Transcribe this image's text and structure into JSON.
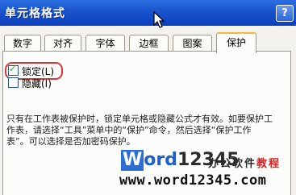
{
  "window": {
    "title": "单元格格式",
    "help_glyph": "?"
  },
  "tabs": [
    {
      "label": "数字"
    },
    {
      "label": "对齐"
    },
    {
      "label": "字体"
    },
    {
      "label": "边框"
    },
    {
      "label": "图案"
    },
    {
      "label": "保护",
      "active": true
    }
  ],
  "options": {
    "locked": {
      "label": "锁定(L)",
      "checked": true
    },
    "hidden": {
      "label": "隐藏(I)",
      "checked": false
    }
  },
  "help_text": [
    "只有在工作表被保护时，锁定单元格或隐藏公式才有效。如要保护工",
    "作表，请选择“工具”菜单中的“保护”命令，然后选择“保护工作",
    "表”。可以选择是否加密码保护。"
  ],
  "watermark": {
    "logo_w": "W",
    "logo_rest": "ord",
    "logo_num": "12345",
    "cn_plain": "办公软件",
    "cn_red": "教程",
    "url": "www.word12345.com"
  },
  "colors": {
    "titlebar": "#1b55cf",
    "active_tab_accent": "#f3b53e",
    "focus_ring": "#d43a3a"
  }
}
